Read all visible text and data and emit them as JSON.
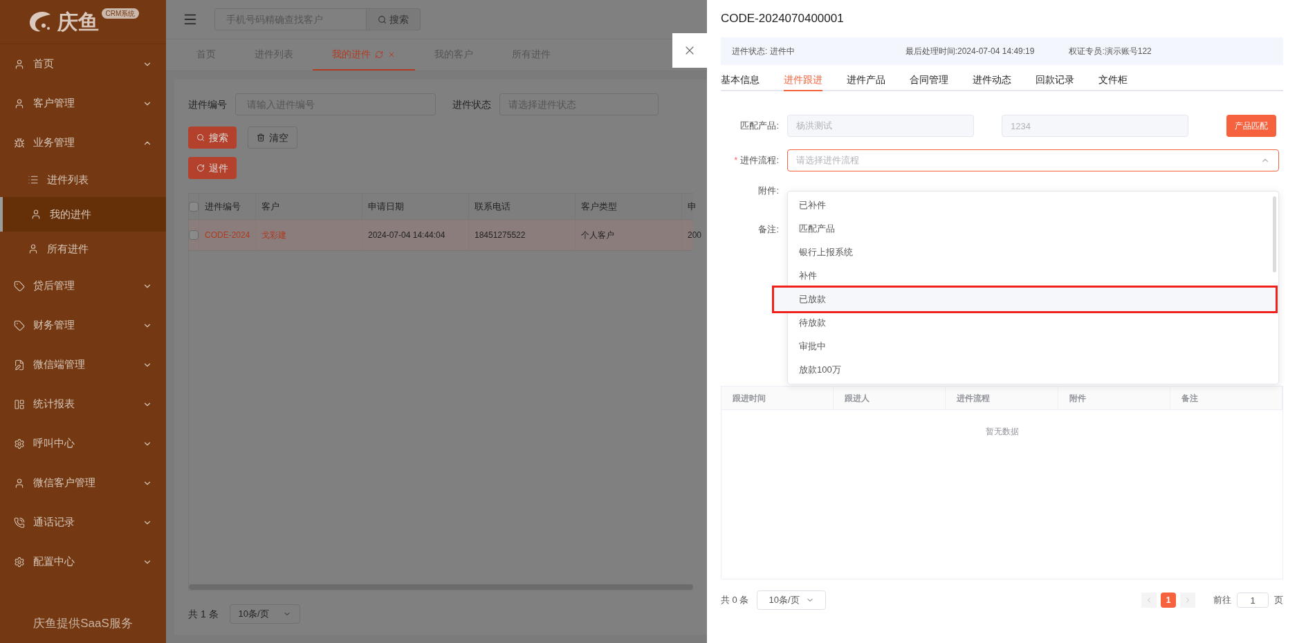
{
  "sidebar": {
    "logo_text": "庆鱼",
    "logo_badge": "CRM系统",
    "items": [
      {
        "label": "首页",
        "expanded": false,
        "selected": false
      },
      {
        "label": "客户管理",
        "expanded": false,
        "selected": false
      },
      {
        "label": "业务管理",
        "expanded": true,
        "selected": false,
        "children": [
          {
            "label": "进件列表",
            "selected": false
          },
          {
            "label": "我的进件",
            "selected": true
          },
          {
            "label": "所有进件",
            "selected": false
          }
        ]
      },
      {
        "label": "贷后管理",
        "expanded": false,
        "selected": false
      },
      {
        "label": "财务管理",
        "expanded": false,
        "selected": false
      },
      {
        "label": "微信端管理",
        "expanded": false,
        "selected": false
      },
      {
        "label": "统计报表",
        "expanded": false,
        "selected": false
      },
      {
        "label": "呼叫中心",
        "expanded": false,
        "selected": false
      },
      {
        "label": "微信客户管理",
        "expanded": false,
        "selected": false
      },
      {
        "label": "通话记录",
        "expanded": false,
        "selected": false
      },
      {
        "label": "配置中心",
        "expanded": false,
        "selected": false
      }
    ],
    "footer": "庆鱼提供SaaS服务"
  },
  "header": {
    "search_placeholder": "手机号码精确查找客户",
    "search_button": "搜索"
  },
  "tabs": [
    {
      "label": "首页",
      "selected": false
    },
    {
      "label": "进件列表",
      "selected": false
    },
    {
      "label": "我的进件",
      "selected": true
    },
    {
      "label": "我的客户",
      "selected": false
    },
    {
      "label": "所有进件",
      "selected": false
    }
  ],
  "filters": [
    {
      "kind": "input",
      "label": "进件编号",
      "placeholder": "请输入进件编号"
    },
    {
      "kind": "select",
      "label": "进件状态",
      "placeholder": "请选择进件状态"
    }
  ],
  "actions": [
    {
      "kind": "primary",
      "label": "搜索"
    },
    {
      "kind": "plain",
      "label": "清空"
    }
  ],
  "return_button": "退件",
  "table": {
    "select_all_checked": false,
    "columns": [
      "进件编号",
      "客户",
      "申请日期",
      "联系电话",
      "客户类型",
      "申"
    ],
    "rows": [
      {
        "checked": false,
        "cells": [
          "CODE-2024",
          "戈彩建",
          "2024-07-04 14:44:04",
          "18451275522",
          "个人客户",
          "200"
        ]
      }
    ],
    "total": "共 1 条",
    "page_size": "10条/页"
  },
  "drawer": {
    "title": "CODE-2024070400001",
    "info": [
      "进件状态: 进件中",
      "最后处理时间:2024-07-04 14:49:19",
      "权证专员:演示账号122"
    ],
    "tabs": [
      {
        "label": "基本信息",
        "selected": false
      },
      {
        "label": "进件跟进",
        "selected": true
      },
      {
        "label": "进件产品",
        "selected": false
      },
      {
        "label": "合同管理",
        "selected": false
      },
      {
        "label": "进件动态",
        "selected": false
      },
      {
        "label": "回款记录",
        "selected": false
      },
      {
        "label": "文件柜",
        "selected": false
      }
    ],
    "form": {
      "product_label": "匹配产品:",
      "product_name": "杨洪测试",
      "product_code": "1234",
      "match_button": "产品匹配",
      "flow_label": "进件流程:",
      "required_mark": "*",
      "flow_placeholder": "请选择进件流程",
      "attachment_label": "附件:",
      "note_label": "备注:"
    },
    "dropdown": {
      "open": true,
      "options": [
        {
          "label": "已补件",
          "highlighted": false
        },
        {
          "label": "匹配产品",
          "highlighted": false
        },
        {
          "label": "银行上报系统",
          "highlighted": false
        },
        {
          "label": "补件",
          "highlighted": false
        },
        {
          "label": "已放款",
          "highlighted": true
        },
        {
          "label": "待放款",
          "highlighted": false
        },
        {
          "label": "审批中",
          "highlighted": false
        },
        {
          "label": "放款100万",
          "highlighted": false
        }
      ]
    },
    "table": {
      "columns": [
        "跟进时间",
        "跟进人",
        "进件流程",
        "附件",
        "备注"
      ],
      "empty_text": "暂无数据"
    },
    "pagination": {
      "total": "共 0 条",
      "page_size": "10条/页",
      "pages": [
        {
          "label": "1",
          "selected": true
        }
      ],
      "goto_label": "前往",
      "goto_value": "1",
      "page_unit": "页"
    }
  }
}
